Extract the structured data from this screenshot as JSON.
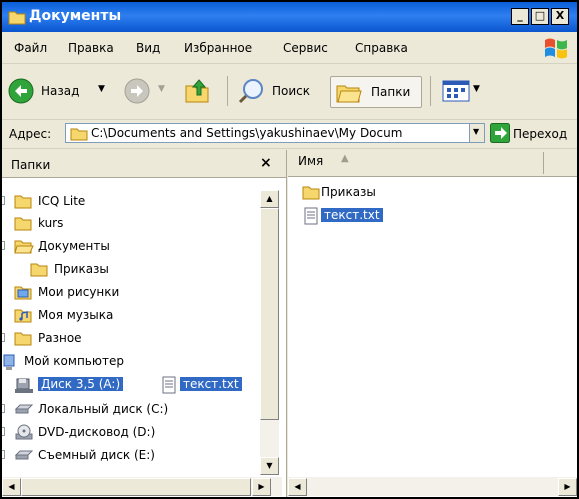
{
  "window": {
    "title": "Документы",
    "controls": [
      "_",
      "□",
      "X"
    ]
  },
  "menu": {
    "items": [
      "Файл",
      "Правка",
      "Вид",
      "Избранное",
      "Сервис",
      "Справка"
    ]
  },
  "toolbar": {
    "back_label": "Назад",
    "search_label": "Поиск",
    "folders_label": "Папки"
  },
  "address": {
    "label": "Адрес:",
    "value": "C:\\Documents and Settings\\yakushinaev\\My Docum",
    "go_label": "Переход"
  },
  "folders_pane": {
    "title": "Папки",
    "close": "×",
    "tree": [
      {
        "label": "ICQ Lite",
        "icon": "folder-icon",
        "expander": true
      },
      {
        "label": "kurs",
        "icon": "folder-icon",
        "expander": false
      },
      {
        "label": "Документы",
        "icon": "open-folder-icon",
        "expander": true
      },
      {
        "label": "Приказы",
        "icon": "folder-icon",
        "expander": false
      },
      {
        "label": "Мои рисунки",
        "icon": "pictures-folder-icon",
        "expander": false
      },
      {
        "label": "Моя музыка",
        "icon": "music-folder-icon",
        "expander": false
      },
      {
        "label": "Разное",
        "icon": "folder-icon",
        "expander": true
      },
      {
        "label": "Мой компьютер",
        "icon": "computer-icon",
        "expander": false
      },
      {
        "label": "Диск 3,5 (A:)",
        "icon": "floppy-icon",
        "expander": false,
        "selected": true
      },
      {
        "label": "Локальный диск (C:)",
        "icon": "hard-disk-icon",
        "expander": true
      },
      {
        "label": "DVD-дисковод (D:)",
        "icon": "dvd-drive-icon",
        "expander": true
      },
      {
        "label": "Съемный диск (E:)",
        "icon": "removable-disk-icon",
        "expander": true
      }
    ],
    "dragged_item": {
      "label": "текст.txt",
      "icon": "text-file-icon"
    }
  },
  "files_pane": {
    "column_name": "Имя",
    "sort_arrow": "▲",
    "files": [
      {
        "label": "Приказы",
        "icon": "folder-icon",
        "selected": false
      },
      {
        "label": "текст.txt",
        "icon": "text-file-icon",
        "selected": true
      }
    ]
  },
  "colors": {
    "titlebar": "#0A5ED8",
    "chrome": "#ECE9D8",
    "selection": "#316AC5",
    "folder": "#F5D76E"
  }
}
